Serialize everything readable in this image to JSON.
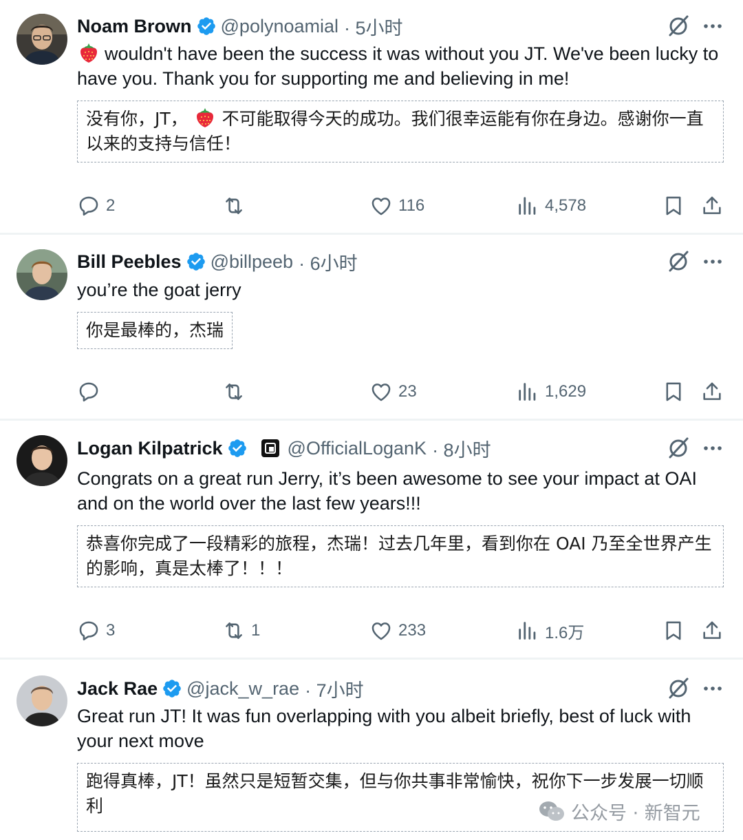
{
  "tweets": [
    {
      "name": "Noam Brown",
      "handle": "@polynoamial",
      "time": "· 5小时",
      "text": "wouldn't have been the success it was without you JT. We've been lucky to have you. Thank you for supporting me and believing in me!",
      "translation_before": "没有你，JT，",
      "translation_after": "不可能取得今天的成功。我们很幸运能有你在身边。感谢你一直以来的支持与信任！",
      "replies": "2",
      "reposts": "",
      "likes": "116",
      "views": "4,578"
    },
    {
      "name": "Bill Peebles",
      "handle": "@billpeeb",
      "time": "· 6小时",
      "text": "you’re the goat jerry",
      "translation": "你是最棒的，杰瑞",
      "replies": "",
      "reposts": "",
      "likes": "23",
      "views": "1,629"
    },
    {
      "name": "Logan Kilpatrick",
      "handle": "@OfficialLoganK",
      "time": "· 8小时",
      "text": "Congrats on a great run Jerry, it’s been awesome to see your impact at OAI and on the world over the last few years!!!",
      "translation": "恭喜你完成了一段精彩的旅程，杰瑞！过去几年里，看到你在 OAI 乃至全世界产生的影响，真是太棒了！！！",
      "replies": "3",
      "reposts": "1",
      "likes": "233",
      "views": "1.6万"
    },
    {
      "name": "Jack Rae",
      "handle": "@jack_w_rae",
      "time": "· 7小时",
      "text": "Great run JT! It was fun overlapping with you albeit briefly, best of luck with your next move",
      "translation": "跑得真棒，JT！虽然只是短暂交集，但与你共事非常愉快，祝你下一步发展一切顺利"
    }
  ],
  "icons": {
    "verified": "verified-badge-icon",
    "grok": "grok-icon",
    "more": "more-options-icon",
    "reply": "reply-icon",
    "repost": "repost-icon",
    "like": "heart-icon",
    "views": "views-chart-icon",
    "bookmark": "bookmark-icon",
    "share": "share-icon",
    "strawberry": "strawberry-emoji-icon",
    "wechat": "wechat-icon"
  },
  "colors": {
    "verified": "#1d9bf0",
    "secondary_text": "#536471",
    "primary_text": "#0f1419",
    "separator": "#eff3f4"
  },
  "watermark": {
    "text": "公众号 · 新智元"
  }
}
